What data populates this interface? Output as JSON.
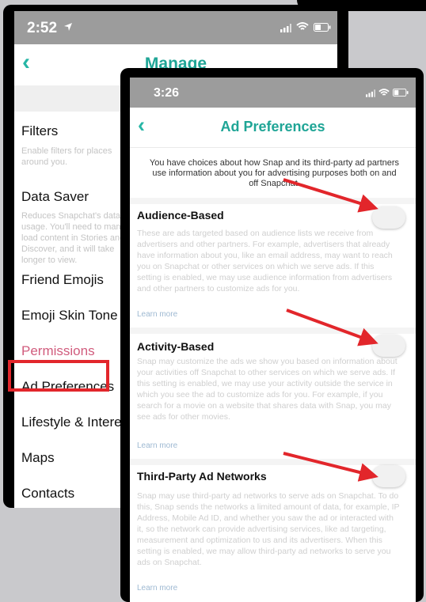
{
  "back_phone": {
    "status": {
      "time": "2:52",
      "location_icon": "location-arrow-icon",
      "signal_icon": "signal-icon",
      "wifi_icon": "wifi-icon",
      "battery_icon": "battery-icon"
    },
    "nav": {
      "back_icon": "chevron-left-icon",
      "title": "Manage"
    },
    "items": [
      {
        "title": "Filters",
        "desc": "Enable filters for places around you."
      },
      {
        "title": "Data Saver",
        "desc": "Reduces Snapchat's data usage. You'll need to manually load content in Stories and Discover, and it will take longer to view."
      }
    ],
    "menu": [
      {
        "label": "Friend Emojis"
      },
      {
        "label": "Emoji Skin Tone"
      },
      {
        "label": "Permissions"
      },
      {
        "label": "Ad Preferences"
      },
      {
        "label": "Lifestyle & Interests"
      },
      {
        "label": "Maps"
      },
      {
        "label": "Contacts"
      }
    ]
  },
  "front_phone": {
    "status": {
      "time": "3:26"
    },
    "nav": {
      "back_icon": "chevron-left-icon",
      "title": "Ad Preferences"
    },
    "intro": "You have choices about how Snap and its third-party ad partners use information about you for advertising purposes both on and off Snapchat.",
    "sections": [
      {
        "title": "Audience-Based",
        "desc": "These are ads targeted based on audience lists we receive from advertisers and other partners. For example, advertisers that already have information about you, like an email address, may want to reach you on Snapchat or other services on which we serve ads. If this setting is enabled, we may use audience information from advertisers and other partners to customize ads for you.",
        "link": "Learn more",
        "enabled": false
      },
      {
        "title": "Activity-Based",
        "desc": "Snap may customize the ads we show you based on information about your activities off Snapchat to other services on which we serve ads. If this setting is enabled, we may use your activity outside the service in which you see the ad to customize ads for you. For example, if you search for a movie on a website that shares data with Snap, you may see ads for other movies.",
        "link": "Learn more",
        "enabled": false
      },
      {
        "title": "Third-Party Ad Networks",
        "desc": "Snap may use third-party ad networks to serve ads on Snapchat. To do this, Snap sends the networks a limited amount of data, for example, IP Address, Mobile Ad ID, and whether you saw the ad or interacted with it, so the network can provide advertising services, like ad targeting, measurement and optimization to us and its advertisers. When this setting is enabled, we may allow third-party ad networks to serve you ads on Snapchat.",
        "link": "Learn more",
        "enabled": false
      }
    ]
  },
  "colors": {
    "accent": "#1fa596",
    "highlight": "#e2262b",
    "permissions": "#d15c7d"
  }
}
